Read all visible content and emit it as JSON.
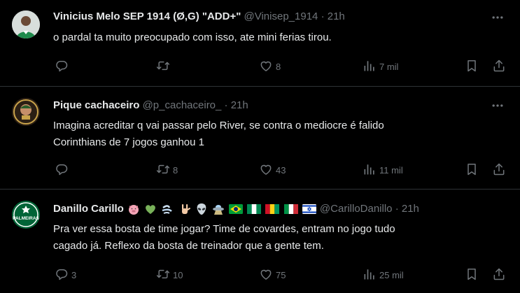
{
  "tweets": [
    {
      "display_name": "Vinicius Melo SEP 1914 (Ø,G) \"ADD+\"",
      "handle": "@Vinisep_1914",
      "dot": "·",
      "time": "21h",
      "text_lines": [
        "o pardal ta muito preocupado com isso, ate mini ferias tirou."
      ],
      "reply_count": "",
      "retweet_count": "",
      "like_count": "8",
      "view_count": "7 mil"
    },
    {
      "display_name": "Pique cachaceiro",
      "handle": "@p_cachaceiro_",
      "dot": "·",
      "time": "21h",
      "text_lines": [
        "Imagina acreditar q vai passar pelo River, se contra o mediocre é falido",
        "Corinthians de 7 jogos ganhou 1"
      ],
      "reply_count": "",
      "retweet_count": "8",
      "like_count": "43",
      "view_count": "11 mil"
    },
    {
      "display_name": "Danillo Carillo",
      "emojis": [
        "pig-face-emoji",
        "green-heart-emoji",
        "wind-face-emoji",
        "horns-hand-emoji",
        "alien-emoji",
        "ufo-emoji",
        "brazil-flag-emoji",
        "nigeria-flag-emoji",
        "guinea-flag-emoji",
        "italy-flag-emoji",
        "israel-flag-emoji"
      ],
      "handle": "@CarilloDanillo",
      "dot": "·",
      "time": "21h",
      "avatar_text": "PALMEIRAS",
      "text_lines": [
        "Pra ver essa bosta de time jogar? Time de covardes, entram no jogo tudo",
        "cagado já. Reflexo da bosta de treinador que a gente tem."
      ],
      "reply_count": "3",
      "retweet_count": "10",
      "like_count": "75",
      "view_count": "25 mil"
    }
  ],
  "colors": {
    "background": "#000000",
    "text": "#e7e9ea",
    "muted": "#71767b",
    "divider": "#2f3336",
    "palmeiras_green": "#006437"
  }
}
